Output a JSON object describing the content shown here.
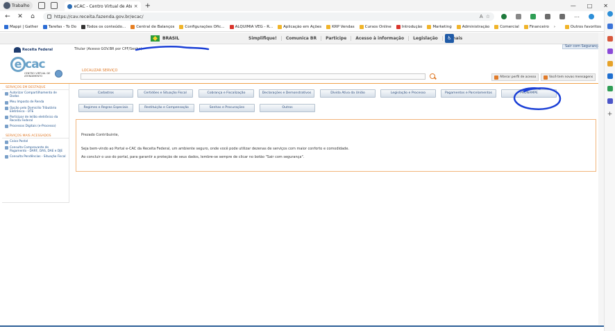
{
  "browser": {
    "profile_label": "Trabalho",
    "tab_title": "eCAC - Centro Virtual de Atendi",
    "tab_close": "×",
    "new_tab": "+",
    "url": "https://cav.receita.fazenda.gov.br/ecac/",
    "window_controls": [
      "—",
      "□",
      "✕"
    ],
    "nav": {
      "back": "←",
      "reload": "✕",
      "home": "⌂"
    },
    "bookmarks": [
      {
        "label": "Mappi | Gather",
        "color": "#2b6cd4"
      },
      {
        "label": "Tarefas - To Do",
        "color": "#2b6cd4"
      },
      {
        "label": "Todos os conteúdo...",
        "color": "#333333"
      },
      {
        "label": "Central de Balanços",
        "color": "#e67e22"
      },
      {
        "label": "Configurações Ofic...",
        "color": "#f0b429"
      },
      {
        "label": "ALQUIMIA VEG - R...",
        "color": "#d9342b"
      },
      {
        "label": "Aplicação em Ações",
        "color": "#f0b429"
      },
      {
        "label": "KRP Vendas",
        "color": "#f0b429"
      },
      {
        "label": "Cursos Online",
        "color": "#f0b429"
      },
      {
        "label": "Introdução",
        "color": "#d9342b"
      },
      {
        "label": "Marketing",
        "color": "#f0b429"
      },
      {
        "label": "Administração",
        "color": "#f0b429"
      },
      {
        "label": "Comercial",
        "color": "#f0b429"
      },
      {
        "label": "Financeiro",
        "color": "#f0b429"
      }
    ],
    "bookmarks_more": "›",
    "bookmarks_other": "Outros favoritos"
  },
  "gov_bar": {
    "brasil": "BRASIL",
    "links": [
      "Simplifique!",
      "Comunica BR",
      "Participe",
      "Acesso à informação",
      "Legislação",
      "Canais"
    ]
  },
  "header": {
    "rf_logo": "Receita Federal",
    "user_line": "Titular (Acesso GOV.BR por CPF/Senha)",
    "exit_button": "Sair com Segurança",
    "ecac_logo_main": "ecac",
    "ecac_logo_sub": "CENTRO VIRTUAL DE ATENDIMENTO",
    "search_label": "LOCALIZAR SERVIÇO",
    "search_value": "",
    "pill_profile": "Alterar perfil de acesso",
    "pill_messages": "Você tem novas mensagens"
  },
  "left_panel": {
    "featured_title": "SERVIÇOS EM DESTAQUE",
    "featured": [
      "Autorizar Compartilhamento de Dados",
      "Meu Imposto de Renda",
      "Opção pelo Domicílio Tributário Eletrônico - DTE",
      "Participar de leilão eletrônico da Receita Federal",
      "Processos Digitais (e-Processo)"
    ],
    "most_title": "SERVIÇOS MAIS ACESSADOS",
    "most": [
      "Caixa Postal",
      "Consulta Comprovante de Pagamento - DARF, DAS, DAE e DJE",
      "Consulta Pendências - Situação Fiscal"
    ]
  },
  "menu": {
    "row1": [
      "Cadastros",
      "Certidões e Situação Fiscal",
      "Cobrança e Fiscalização",
      "Declarações e Demonstrativos",
      "Dívida Ativa da União",
      "Legislação e Processo",
      "Pagamentos e Parcelamentos",
      "PRONAMPE"
    ],
    "row2": [
      "Regimes e Regras Especiais",
      "Restituição e Compensação",
      "Senhas e Procurações",
      "Outros"
    ]
  },
  "welcome": {
    "greeting": "Prezado Contribuinte,",
    "p1": "Seja bem-vindo ao Portal e-CAC da Receita Federal, um ambiente seguro, onde você pode utilizar dezenas de serviços com maior conforto e comodidade.",
    "p2": "Ao concluir o uso do portal, para garantir a proteção de seus dados, lembre-se sempre de clicar no botão \"Sair com segurança\"."
  },
  "colors": {
    "accent_orange": "#e07b2a",
    "link_blue": "#1c4f8a",
    "annotation_blue": "#1a3fd6"
  }
}
